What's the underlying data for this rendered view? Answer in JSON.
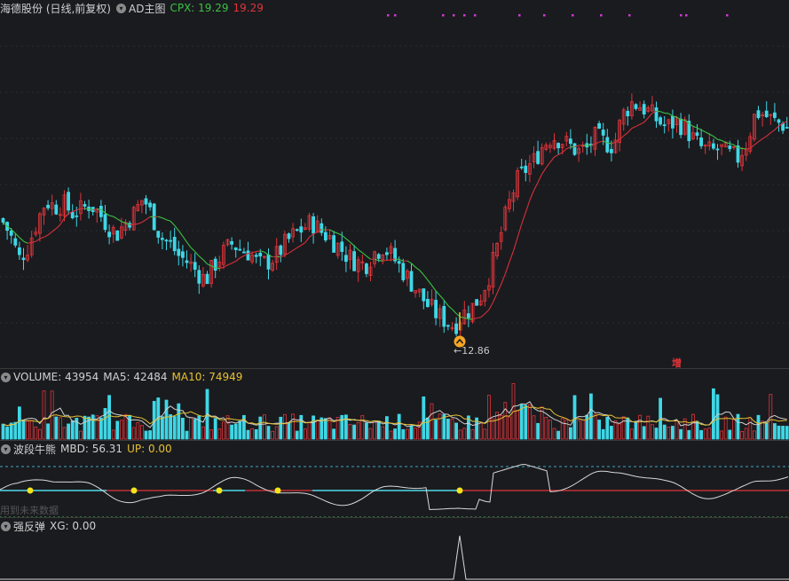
{
  "main": {
    "title": "海德股份 (日线,前复权)",
    "indicator": "AD主图",
    "cpx_label": "CPX: 19.29",
    "price_label": "19.29",
    "low_marker": "←12.86",
    "zeng_label": "增",
    "colors": {
      "up": "#e0353a",
      "down": "#3fd7e6",
      "ma_red": "#d8303a",
      "ma_green": "#3bc244",
      "magenta": "#d03ad0"
    }
  },
  "volume": {
    "title": "VOLUME: 43954",
    "ma5": "MA5: 42484",
    "ma10": "MA10: 74949"
  },
  "wave": {
    "title": "波段牛熊",
    "mbd": "MBD: 56.31",
    "up": "UP: 0.00",
    "watermark": "用到未来数据"
  },
  "rebound": {
    "title": "强反弹",
    "xg": "XG: 0.00"
  },
  "chart_data": {
    "type": "candlestick",
    "price_path": [
      [
        0,
        16.4
      ],
      [
        10,
        15.9
      ],
      [
        20,
        15.1
      ],
      [
        30,
        15.5
      ],
      [
        40,
        16.3
      ],
      [
        50,
        17.0
      ],
      [
        60,
        16.8
      ],
      [
        70,
        16.9
      ],
      [
        80,
        16.6
      ],
      [
        90,
        16.7
      ],
      [
        100,
        16.9
      ],
      [
        110,
        16.6
      ],
      [
        120,
        16.2
      ],
      [
        130,
        15.9
      ],
      [
        140,
        16.3
      ],
      [
        150,
        16.6
      ],
      [
        160,
        17.1
      ],
      [
        170,
        16.5
      ],
      [
        180,
        15.8
      ],
      [
        190,
        15.6
      ],
      [
        200,
        15.2
      ],
      [
        210,
        15.0
      ],
      [
        220,
        14.7
      ],
      [
        230,
        14.4
      ],
      [
        240,
        14.9
      ],
      [
        250,
        15.3
      ],
      [
        260,
        15.6
      ],
      [
        270,
        15.4
      ],
      [
        280,
        15.3
      ],
      [
        290,
        14.9
      ],
      [
        300,
        15.0
      ],
      [
        310,
        15.2
      ],
      [
        320,
        15.6
      ],
      [
        330,
        15.9
      ],
      [
        340,
        16.1
      ],
      [
        350,
        16.3
      ],
      [
        360,
        16.0
      ],
      [
        370,
        15.8
      ],
      [
        380,
        15.5
      ],
      [
        390,
        15.2
      ],
      [
        400,
        15.0
      ],
      [
        410,
        14.9
      ],
      [
        420,
        15.3
      ],
      [
        430,
        15.5
      ],
      [
        440,
        15.2
      ],
      [
        450,
        14.8
      ],
      [
        460,
        14.4
      ],
      [
        470,
        14.0
      ],
      [
        480,
        13.6
      ],
      [
        490,
        13.3
      ],
      [
        500,
        13.1
      ],
      [
        510,
        12.9
      ],
      [
        520,
        13.3
      ],
      [
        530,
        13.5
      ],
      [
        540,
        13.9
      ],
      [
        550,
        14.6
      ],
      [
        560,
        15.6
      ],
      [
        570,
        16.7
      ],
      [
        580,
        17.6
      ],
      [
        590,
        18.0
      ],
      [
        600,
        18.3
      ],
      [
        610,
        18.8
      ],
      [
        620,
        19.1
      ],
      [
        630,
        19.0
      ],
      [
        640,
        18.8
      ],
      [
        650,
        18.6
      ],
      [
        660,
        18.7
      ],
      [
        670,
        19.1
      ],
      [
        680,
        18.9
      ],
      [
        690,
        18.8
      ],
      [
        700,
        19.8
      ],
      [
        710,
        20.2
      ],
      [
        720,
        20.1
      ],
      [
        730,
        19.9
      ],
      [
        740,
        19.6
      ],
      [
        750,
        19.4
      ],
      [
        760,
        19.6
      ],
      [
        770,
        19.4
      ],
      [
        780,
        19.0
      ],
      [
        790,
        18.7
      ],
      [
        800,
        18.6
      ],
      [
        810,
        18.7
      ],
      [
        820,
        18.5
      ],
      [
        830,
        18.4
      ],
      [
        840,
        18.9
      ],
      [
        850,
        19.9
      ],
      [
        860,
        19.8
      ],
      [
        870,
        19.6
      ],
      [
        880,
        19.5
      ],
      [
        889,
        19.3
      ]
    ],
    "low_point": 12.86,
    "last_close": 19.29
  }
}
